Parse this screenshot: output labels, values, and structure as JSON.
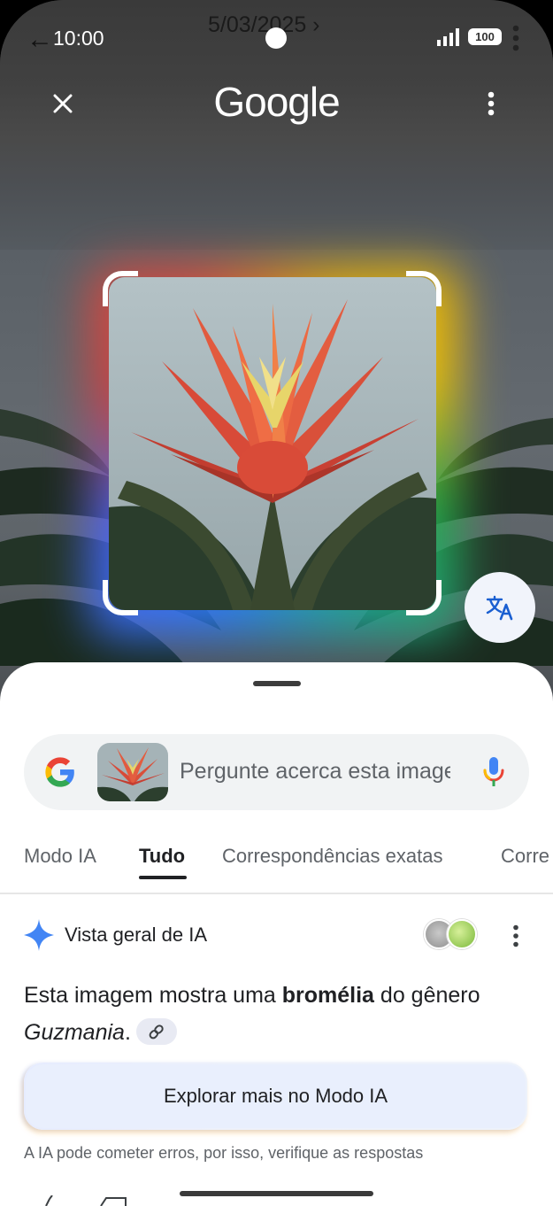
{
  "status_bar": {
    "time": "10:00",
    "date": "5/03/2025 ›",
    "battery": "100"
  },
  "header": {
    "logo": "Google",
    "close_icon": "close-icon",
    "menu_icon": "more-vert-icon"
  },
  "search": {
    "placeholder": "Pergunte acerca esta imagem"
  },
  "tabs": [
    {
      "label": "Modo IA",
      "active": false
    },
    {
      "label": "Tudo",
      "active": true
    },
    {
      "label": "Correspondências exatas",
      "active": false
    },
    {
      "label": "Corre",
      "active": false
    }
  ],
  "ai_overview": {
    "title": "Vista geral de IA",
    "text_prefix": "Esta imagem mostra uma ",
    "text_bold": "bromélia",
    "text_middle": " do gênero",
    "text_italic": "Guzmania",
    "text_suffix": "."
  },
  "explore_button": "Explorar mais no Modo IA",
  "disclaimer": "A IA pode cometer erros, por isso, verifique as respostas",
  "colors": {
    "accent_blue": "#4285F4",
    "sheet_bg": "#ffffff",
    "explore_bg": "#e9effd"
  }
}
